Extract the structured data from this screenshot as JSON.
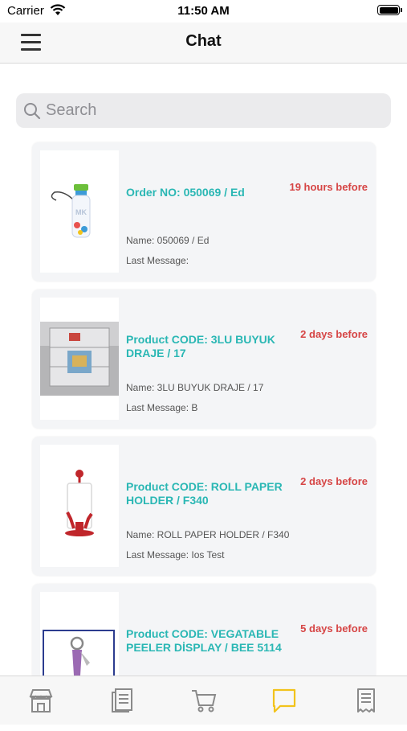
{
  "status_bar": {
    "carrier": "Carrier",
    "time": "11:50 AM"
  },
  "navbar": {
    "title": "Chat"
  },
  "search": {
    "placeholder": "Search",
    "value": ""
  },
  "chats": [
    {
      "title": "Order NO: 050069 / Ed",
      "time": "19 hours before",
      "name": "Name: 050069 / Ed",
      "last_message": "Last Message:",
      "thumbnail": "water-bottle"
    },
    {
      "title": "Product CODE: 3LU BUYUK DRAJE / 17",
      "time": "2 days before",
      "name": "Name: 3LU BUYUK DRAJE / 17",
      "last_message": "Last Message: B",
      "thumbnail": "plastic-containers"
    },
    {
      "title": "Product CODE: ROLL PAPER HOLDER / F340",
      "time": "2 days before",
      "name": "Name: ROLL PAPER HOLDER / F340",
      "last_message": "Last Message: Ios Test",
      "thumbnail": "paper-roll-holder"
    },
    {
      "title": "Product CODE: VEGATABLE PEELER DİSPLAY / BEE 5114",
      "time": "5 days before",
      "name": "",
      "last_message": "",
      "thumbnail": "vegetable-peeler"
    }
  ],
  "tab_bar": {
    "items": [
      {
        "icon": "store-icon",
        "active": false
      },
      {
        "icon": "catalog-icon",
        "active": false
      },
      {
        "icon": "cart-icon",
        "active": false
      },
      {
        "icon": "chat-icon",
        "active": true
      },
      {
        "icon": "receipt-icon",
        "active": false
      }
    ]
  },
  "colors": {
    "accent_title": "#2ab7b4",
    "time_red": "#d64545",
    "active_tab": "#f2c31b",
    "inactive_tab": "#8a8a8a"
  }
}
